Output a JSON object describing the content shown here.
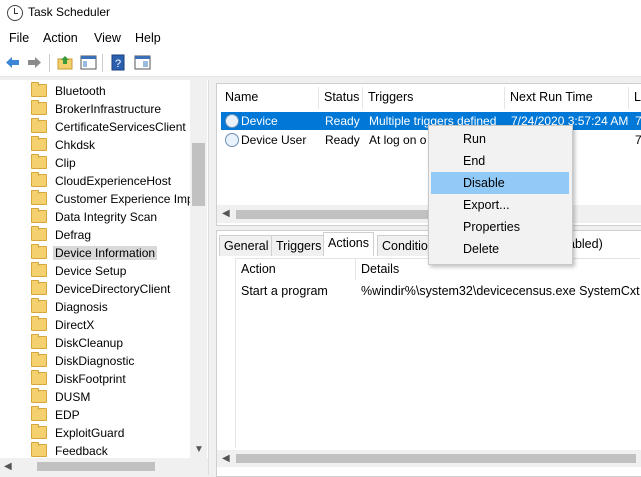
{
  "window": {
    "title": "Task Scheduler"
  },
  "menubar": {
    "items": [
      "File",
      "Action",
      "View",
      "Help"
    ]
  },
  "toolbar": {
    "icons": [
      "back-arrow-icon",
      "forward-arrow-icon",
      "up-folder-icon",
      "show-hide-pane-icon",
      "help-icon",
      "action-pane-icon"
    ]
  },
  "tree": {
    "items": [
      {
        "label": "Bluetooth"
      },
      {
        "label": "BrokerInfrastructure"
      },
      {
        "label": "CertificateServicesClient"
      },
      {
        "label": "Chkdsk"
      },
      {
        "label": "Clip"
      },
      {
        "label": "CloudExperienceHost"
      },
      {
        "label": "Customer Experience Imp"
      },
      {
        "label": "Data Integrity Scan"
      },
      {
        "label": "Defrag"
      },
      {
        "label": "Device Information",
        "selected": true
      },
      {
        "label": "Device Setup"
      },
      {
        "label": "DeviceDirectoryClient"
      },
      {
        "label": "Diagnosis"
      },
      {
        "label": "DirectX"
      },
      {
        "label": "DiskCleanup"
      },
      {
        "label": "DiskDiagnostic"
      },
      {
        "label": "DiskFootprint"
      },
      {
        "label": "DUSM"
      },
      {
        "label": "EDP"
      },
      {
        "label": "ExploitGuard"
      },
      {
        "label": "Feedback"
      }
    ]
  },
  "tasklist": {
    "columns": [
      "Name",
      "Status",
      "Triggers",
      "Next Run Time",
      "L"
    ],
    "rows": [
      {
        "name": "Device",
        "status": "Ready",
        "triggers": "Multiple triggers defined",
        "next_run": "7/24/2020 3:57:24 AM",
        "last": "7",
        "selected": true
      },
      {
        "name": "Device User",
        "status": "Ready",
        "triggers": "At log on o",
        "next_run": "",
        "last": "7",
        "selected": false
      }
    ]
  },
  "details": {
    "tabs": [
      "General",
      "Triggers",
      "Actions",
      "Conditio",
      "abled)"
    ],
    "active_tab": "Actions",
    "columns": [
      "Action",
      "Details"
    ],
    "rows": [
      {
        "action": "Start a program",
        "details": "%windir%\\system32\\devicecensus.exe SystemCxt"
      }
    ]
  },
  "context_menu": {
    "items": [
      "Run",
      "End",
      "Disable",
      "Export...",
      "Properties",
      "Delete"
    ],
    "highlighted": "Disable"
  },
  "colors": {
    "selection": "#0078d7",
    "menu_highlight": "#91c9f7"
  }
}
